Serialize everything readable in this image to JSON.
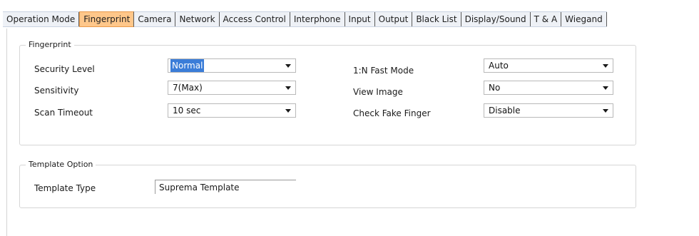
{
  "tabs": [
    "Operation Mode",
    "Fingerprint",
    "Camera",
    "Network",
    "Access Control",
    "Interphone",
    "Input",
    "Output",
    "Black List",
    "Display/Sound",
    "T & A",
    "Wiegand"
  ],
  "active_tab": "Fingerprint",
  "fingerprint_group": {
    "title": "Fingerprint",
    "security_level": {
      "label": "Security Level",
      "value": "Normal"
    },
    "sensitivity": {
      "label": "Sensitivity",
      "value": "7(Max)"
    },
    "scan_timeout": {
      "label": "Scan Timeout",
      "value": "10 sec"
    },
    "fast_mode": {
      "label": "1:N Fast Mode",
      "value": "Auto"
    },
    "view_image": {
      "label": "View Image",
      "value": "No"
    },
    "check_fake": {
      "label": "Check Fake Finger",
      "value": "Disable"
    }
  },
  "template_group": {
    "title": "Template Option",
    "template_type": {
      "label": "Template Type",
      "value": "Suprema Template"
    }
  }
}
